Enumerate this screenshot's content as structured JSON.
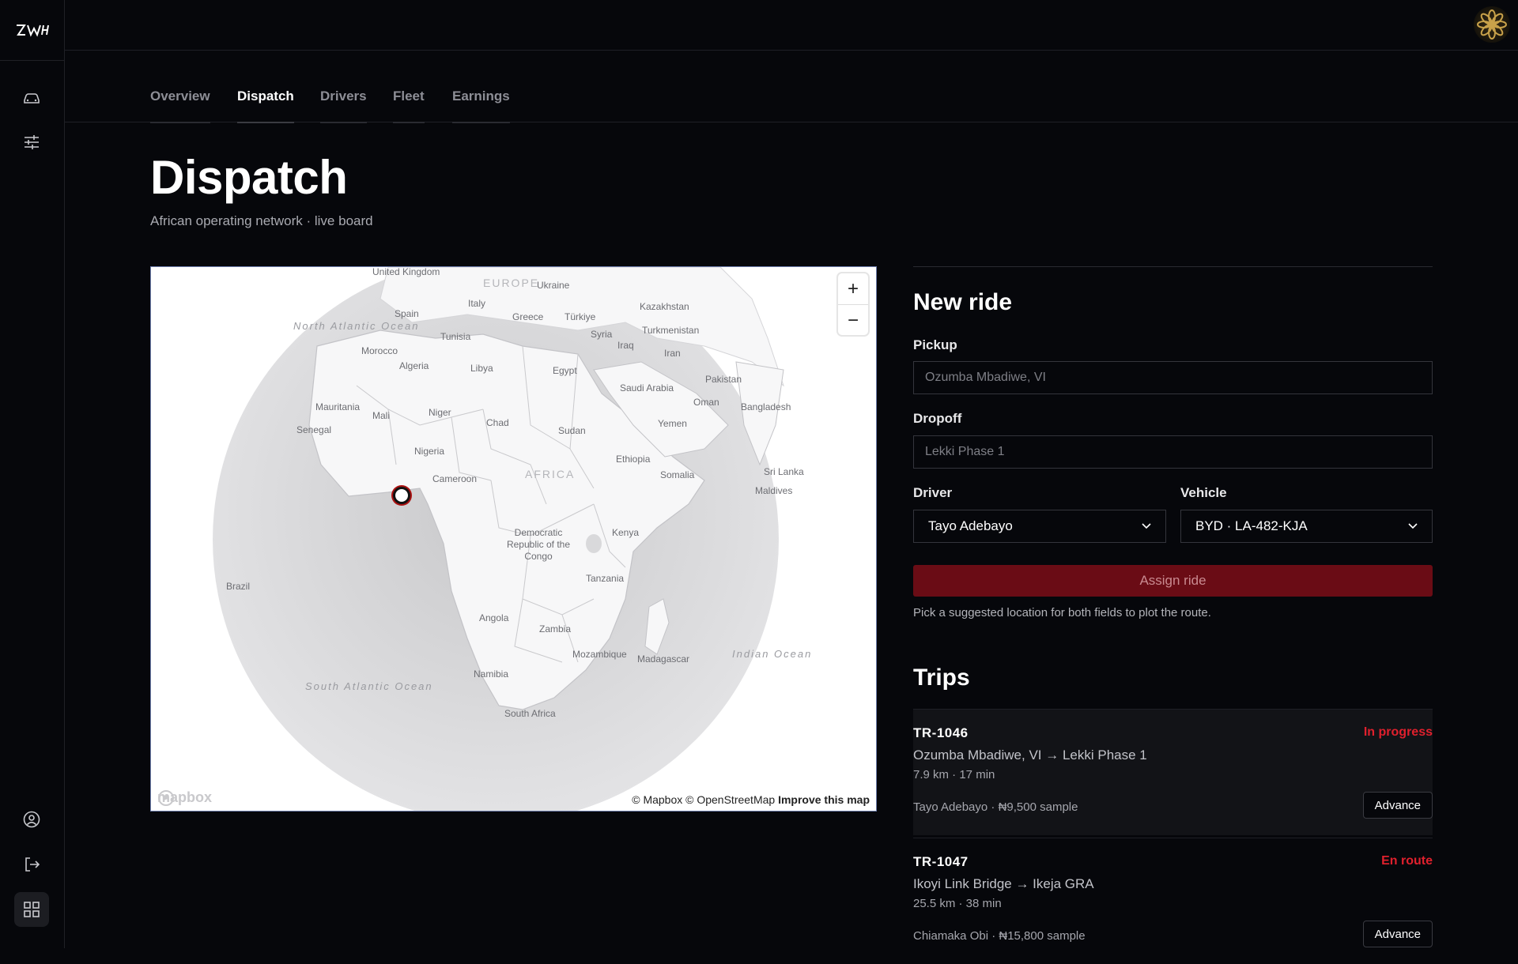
{
  "nav": {
    "tabs": [
      {
        "label": "Overview"
      },
      {
        "label": "Dispatch"
      },
      {
        "label": "Drivers"
      },
      {
        "label": "Fleet"
      },
      {
        "label": "Earnings"
      }
    ],
    "active_tab": "Dispatch"
  },
  "header": {
    "title": "Dispatch",
    "subtitle": "African operating network · live board"
  },
  "map": {
    "labels": {
      "united_kingdom": "United Kingdom",
      "europe": "EUROPE",
      "ukraine": "Ukraine",
      "kazakhstan": "Kazakhstan",
      "spain": "Spain",
      "italy": "Italy",
      "greece": "Greece",
      "turkiye": "Türkiye",
      "turkmenistan": "Turkmenistan",
      "north_atlantic": "North Atlantic Ocean",
      "tunisia": "Tunisia",
      "syria": "Syria",
      "iraq": "Iraq",
      "iran": "Iran",
      "morocco": "Morocco",
      "algeria": "Algeria",
      "libya": "Libya",
      "egypt": "Egypt",
      "saudi_arabia": "Saudi Arabia",
      "pakistan": "Pakistan",
      "oman": "Oman",
      "bangladesh": "Bangladesh",
      "mauritania": "Mauritania",
      "mali": "Mali",
      "niger": "Niger",
      "chad": "Chad",
      "sudan": "Sudan",
      "yemen": "Yemen",
      "senegal": "Senegal",
      "nigeria": "Nigeria",
      "ethiopia": "Ethiopia",
      "cameroon": "Cameroon",
      "africa": "AFRICA",
      "somalia": "Somalia",
      "sri_lanka": "Sri Lanka",
      "maldives": "Maldives",
      "drc": "Democratic Republic of the Congo",
      "kenya": "Kenya",
      "brazil": "Brazil",
      "tanzania": "Tanzania",
      "angola": "Angola",
      "zambia": "Zambia",
      "mozambique": "Mozambique",
      "madagascar": "Madagascar",
      "indian_ocean": "Indian Ocean",
      "namibia": "Namibia",
      "south_atlantic": "South Atlantic Ocean",
      "south_africa": "South Africa"
    },
    "zoom_in": "+",
    "zoom_out": "−",
    "attribution": "© Mapbox © OpenStreetMap",
    "improve": "Improve this map",
    "logo": "mapbox"
  },
  "new_ride": {
    "title": "New ride",
    "pickup_label": "Pickup",
    "pickup_placeholder": "Ozumba Mbadiwe, VI",
    "dropoff_label": "Dropoff",
    "dropoff_placeholder": "Lekki Phase 1",
    "driver_label": "Driver",
    "driver_value": "Tayo Adebayo",
    "vehicle_label": "Vehicle",
    "vehicle_value": "BYD · LA-482-KJA",
    "assign_label": "Assign ride",
    "hint": "Pick a suggested location for both fields to plot the route."
  },
  "trips": {
    "title": "Trips",
    "items": [
      {
        "id": "TR-1046",
        "status": "In progress",
        "route": "Ozumba Mbadiwe, VI → Lekki Phase 1",
        "meta": "7.9 km · 17 min",
        "driver": "Tayo Adebayo · ₦9,500 sample",
        "action": "Advance"
      },
      {
        "id": "TR-1047",
        "status": "En route",
        "route": "Ikoyi Link Bridge → Ikeja GRA",
        "meta": "25.5 km · 38 min",
        "driver": "Chiamaka Obi · ₦15,800 sample",
        "action": "Advance"
      }
    ]
  },
  "colors": {
    "background": "#06070b",
    "accent": "#6a0c15",
    "status": "#e0202d"
  },
  "icons": {
    "sidebar": [
      "car-icon",
      "sliders-icon",
      "user-circle-icon",
      "logout-icon",
      "grid-icon"
    ],
    "avatar": "gold-flower-avatar"
  }
}
